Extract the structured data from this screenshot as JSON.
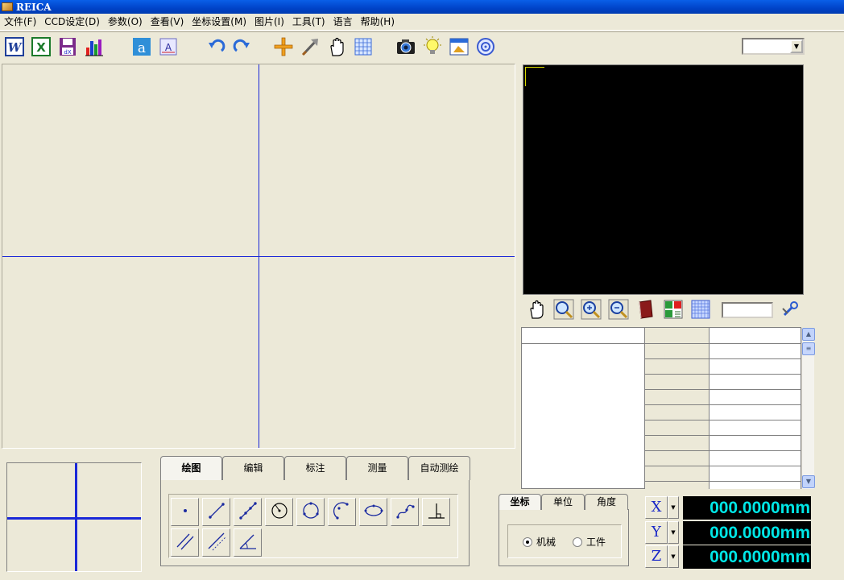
{
  "app": {
    "title": "REICA"
  },
  "menus": [
    "文件(F)",
    "CCD设定(D)",
    "参数(O)",
    "查看(V)",
    "坐标设置(M)",
    "图片(I)",
    "工具(T)",
    "语言",
    "帮助(H)"
  ],
  "toolbar": {
    "groups": [
      {
        "icons": [
          "word-export-icon",
          "excel-export-icon",
          "dxf-export-icon",
          "statistics-chart-icon"
        ]
      },
      {
        "icons": [
          "font-icon",
          "text-annotation-icon"
        ]
      },
      {
        "icons": [
          "undo-icon",
          "redo-icon"
        ]
      },
      {
        "icons": [
          "crosshair-icon",
          "pick-tool-icon",
          "hand-pan-icon",
          "grid-icon"
        ]
      },
      {
        "icons": [
          "camera-capture-icon",
          "light-bulb-icon",
          "image-window-icon",
          "lens-settings-icon"
        ]
      }
    ],
    "combo_value": ""
  },
  "view_toolbar": {
    "icons": [
      "view-hand-icon",
      "zoom-icon",
      "zoom-in-icon",
      "zoom-out-icon",
      "book-icon",
      "layout-icon",
      "grid-display-icon"
    ],
    "input_value": "",
    "settings_icon": "wrench-icon"
  },
  "draw_tabs": [
    "绘图",
    "编辑",
    "标注",
    "测量",
    "自动测绘"
  ],
  "draw_tools": [
    {
      "icon": "point-tool-icon"
    },
    {
      "icon": "line-tool-icon"
    },
    {
      "icon": "multi-point-line-tool-icon"
    },
    {
      "icon": "circle-center-tool-icon"
    },
    {
      "icon": "circle-tool-icon"
    },
    {
      "icon": "arc-tool-icon"
    },
    {
      "icon": "ellipse-tool-icon"
    },
    {
      "icon": "curve-tool-icon"
    },
    {
      "icon": "perpendicular-tool-icon"
    },
    {
      "icon": "parallel-lines-tool-icon"
    },
    {
      "icon": "midline-tool-icon"
    },
    {
      "icon": "angle-tool-icon"
    }
  ],
  "coord_tabs": [
    "坐标",
    "单位",
    "角度"
  ],
  "coord_mode": {
    "options": [
      "机械",
      "工件"
    ],
    "selected": "机械"
  },
  "axes": [
    {
      "label": "X",
      "value": "000.0000mm"
    },
    {
      "label": "Y",
      "value": "000.0000mm"
    },
    {
      "label": "Z",
      "value": "000.0000mm"
    }
  ],
  "colors": {
    "readout_text": "#00e6e6",
    "crosshair": "#1a28d8",
    "camera_bg": "#000000",
    "window_bg": "#ece9d8"
  }
}
